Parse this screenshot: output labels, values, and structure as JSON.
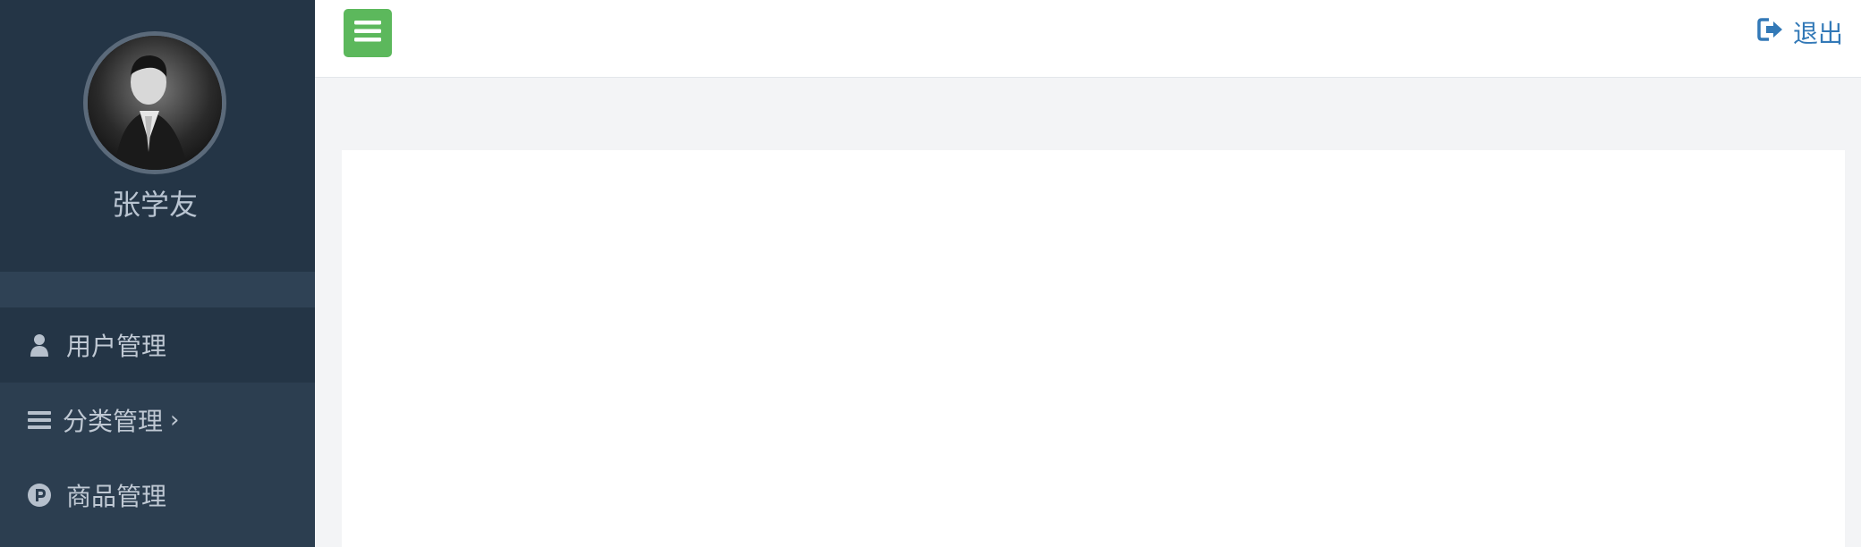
{
  "profile": {
    "username": "张学友"
  },
  "sidebar": {
    "items": [
      {
        "label": "用户管理",
        "icon": "user-icon",
        "active": true
      },
      {
        "label": "分类管理",
        "icon": "list-icon",
        "chevron": "›"
      },
      {
        "label": "商品管理",
        "icon": "parking-circle-icon"
      }
    ]
  },
  "header": {
    "logout_label": "退出"
  },
  "colors": {
    "sidebar_bg": "#2c3e50",
    "sidebar_active": "#243546",
    "toggle_button": "#5cb85c",
    "logout_link": "#3379b7",
    "page_bg": "#f3f4f6"
  }
}
